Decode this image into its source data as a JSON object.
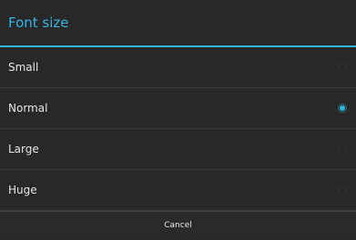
{
  "dialog": {
    "title": "Font size",
    "accent_color": "#33b5e5",
    "options": [
      {
        "label": "Small",
        "checked": false
      },
      {
        "label": "Normal",
        "checked": true
      },
      {
        "label": "Large",
        "checked": false
      },
      {
        "label": "Huge",
        "checked": false
      }
    ],
    "cancel_label": "Cancel"
  }
}
